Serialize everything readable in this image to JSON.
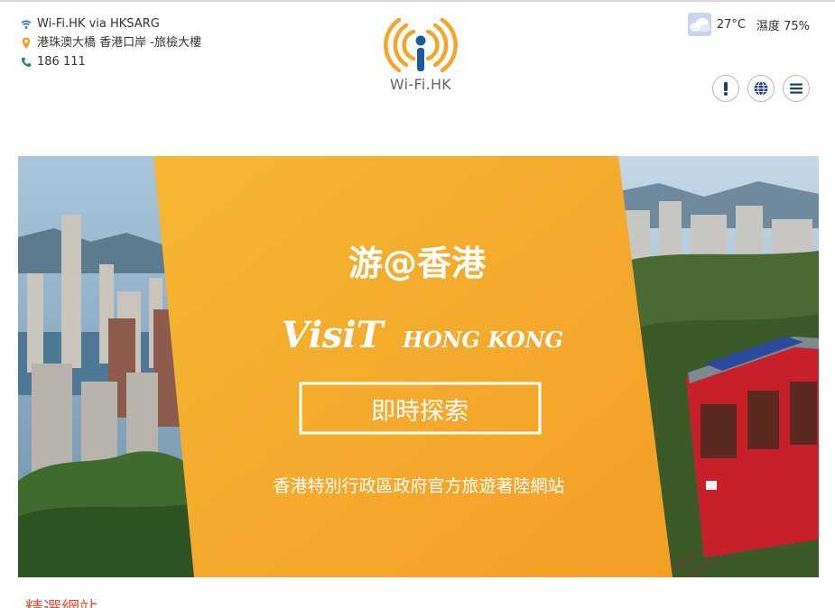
{
  "header": {
    "network": "Wi-Fi.HK via HKSARG",
    "location": "港珠澳大橋 香港口岸 -旅檢大樓",
    "phone": "186 111",
    "logo_text": "Wi-Fi.HK"
  },
  "weather": {
    "temperature": "27°C",
    "humidity": "濕度 75%",
    "icon": "cloudy-icon"
  },
  "buttons": {
    "alert_icon": "exclamation-icon",
    "language_icon": "globe-icon",
    "menu_icon": "hamburger-menu-icon"
  },
  "banner": {
    "logo_cn": "游@香港",
    "logo_visit": "VisiT",
    "logo_hk": "HONG KONG",
    "cta": "即時探索",
    "subtitle": "香港特別行政區政府官方旅遊著陸網站"
  },
  "section": {
    "title_partial": "精選網站"
  },
  "colors": {
    "accent_orange": "#f7a824",
    "tram_red": "#c8202a",
    "icon_blue": "#1a5aa0",
    "section_red": "#e0543c"
  }
}
